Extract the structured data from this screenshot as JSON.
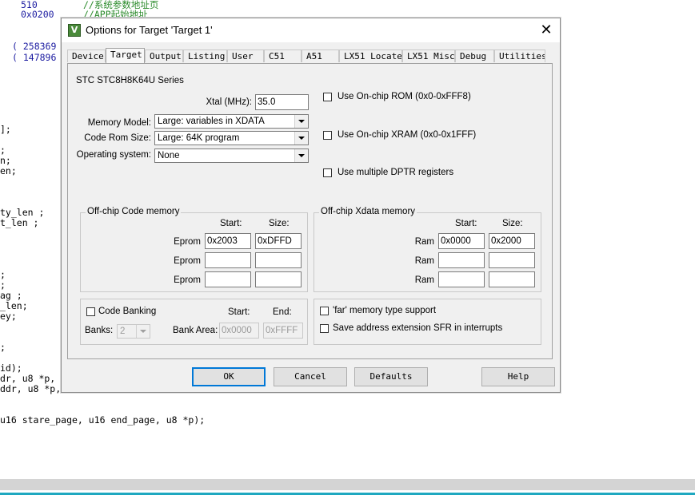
{
  "editor": {
    "lines": [
      {
        "a": "510",
        "b": "//系统参数地址页"
      },
      {
        "a": "0x0200",
        "b": "//APP起始地址"
      },
      {
        "a": "( 258369"
      },
      {
        "a": "( 147896"
      },
      {
        "a": "];"
      },
      {
        "a": ";"
      },
      {
        "a": "n;"
      },
      {
        "a": "en;"
      },
      {
        "a": "ty_len ;"
      },
      {
        "a": "t_len ;"
      },
      {
        "a": ";"
      },
      {
        "a": ";"
      },
      {
        "a": "ag ;"
      },
      {
        "a": "_len;"
      },
      {
        "a": "ey;"
      },
      {
        "a": ";"
      },
      {
        "a": "id);"
      },
      {
        "a": "dr, u8 *p,"
      },
      {
        "a": "ddr, u8 *p,"
      },
      {
        "a": "u16 stare_page, u16 end_page, u8 *p);"
      }
    ]
  },
  "dialog": {
    "title": "Options for Target 'Target 1'",
    "close_glyph": "✕",
    "icon_glyph": "V",
    "tabs": [
      "Device",
      "Target",
      "Output",
      "Listing",
      "User",
      "C51",
      "A51",
      "LX51 Locate",
      "LX51 Misc",
      "Debug",
      "Utilities"
    ],
    "active_tab": "Target",
    "device_name": "STC STC8H8K64U Series",
    "xtal_label": "Xtal (MHz):",
    "xtal_value": "35.0",
    "memory_model_label": "Memory Model:",
    "memory_model_value": "Large: variables in XDATA",
    "code_rom_label": "Code Rom Size:",
    "code_rom_value": "Large: 64K program",
    "os_label": "Operating system:",
    "os_value": "None",
    "use_onchip_rom": "Use On-chip ROM (0x0-0xFFF8)",
    "use_onchip_xram": "Use On-chip XRAM (0x0-0x1FFF)",
    "use_multiple_dptr": "Use multiple DPTR registers",
    "offchip_code": {
      "title": "Off-chip Code memory",
      "start_header": "Start:",
      "size_header": "Size:",
      "rows": [
        {
          "label": "Eprom",
          "start": "0x2003",
          "size": "0xDFFD"
        },
        {
          "label": "Eprom",
          "start": "",
          "size": ""
        },
        {
          "label": "Eprom",
          "start": "",
          "size": ""
        }
      ]
    },
    "offchip_xdata": {
      "title": "Off-chip Xdata memory",
      "start_header": "Start:",
      "size_header": "Size:",
      "rows": [
        {
          "label": "Ram",
          "start": "0x0000",
          "size": "0x2000"
        },
        {
          "label": "Ram",
          "start": "",
          "size": ""
        },
        {
          "label": "Ram",
          "start": "",
          "size": ""
        }
      ]
    },
    "banking": {
      "code_banking_label": "Code Banking",
      "start_header": "Start:",
      "end_header": "End:",
      "banks_label": "Banks:",
      "banks_value": "2",
      "bank_area_label": "Bank Area:",
      "bank_area_start": "0x0000",
      "bank_area_end": "0xFFFF"
    },
    "far_memory_label": "'far' memory type support",
    "save_sfr_label": "Save address extension SFR in interrupts",
    "buttons": {
      "ok": "OK",
      "cancel": "Cancel",
      "defaults": "Defaults",
      "help": "Help"
    }
  }
}
